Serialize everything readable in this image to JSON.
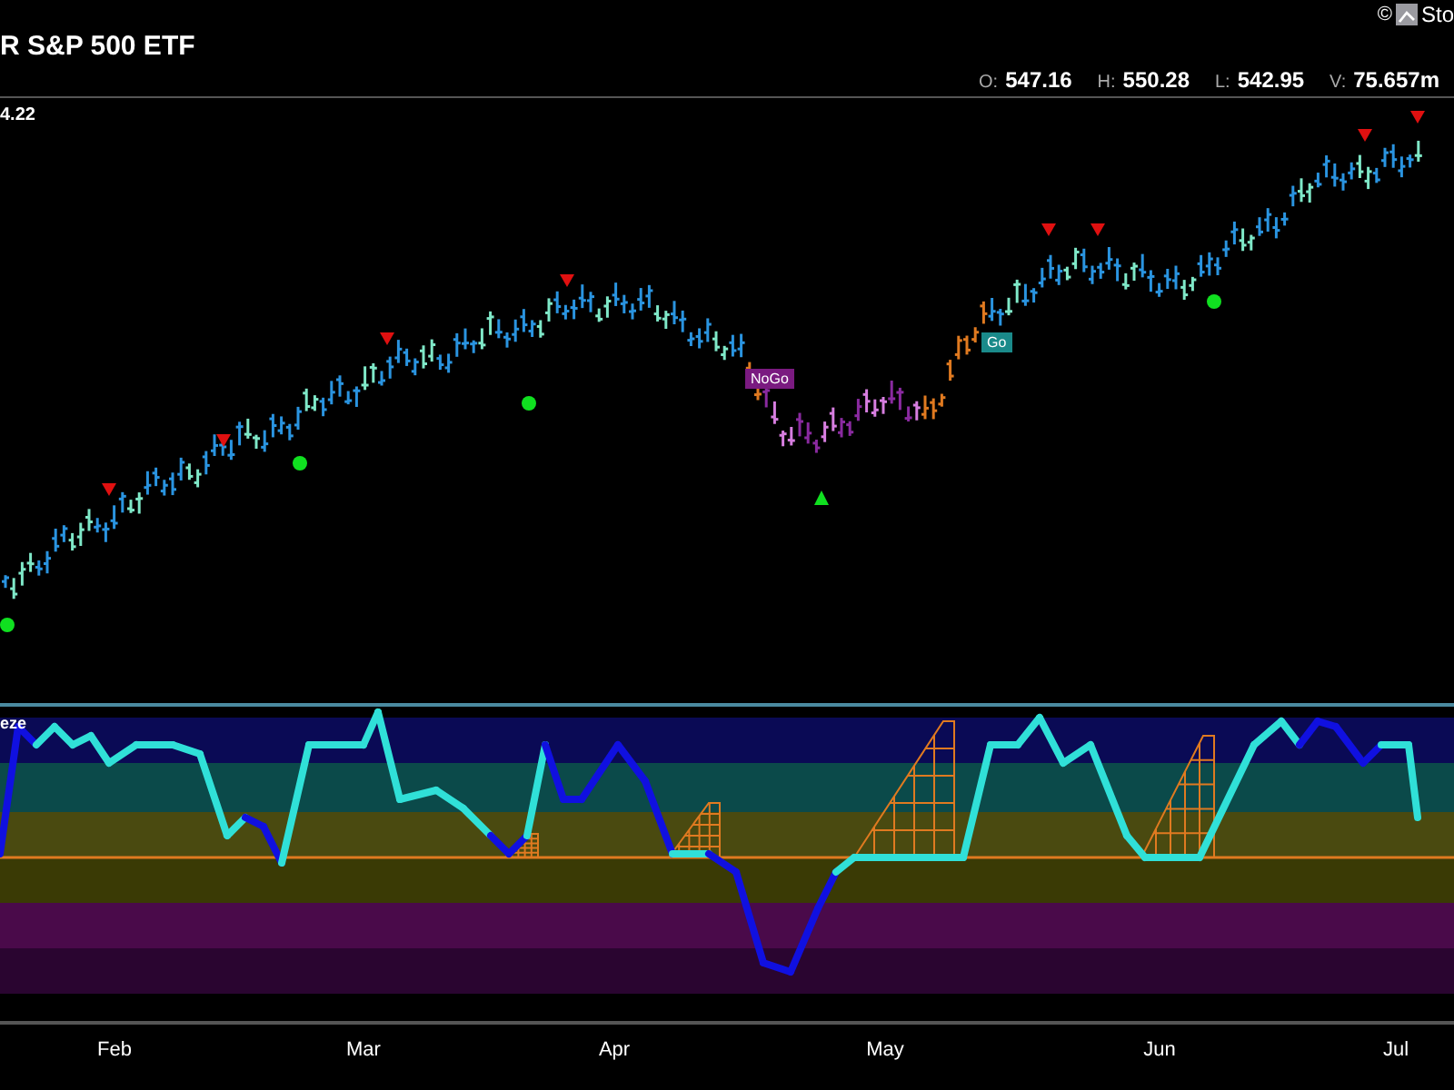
{
  "header": {
    "title": "R S&P 500 ETF",
    "copyright": "©",
    "credit": "Sto",
    "quote": [
      {
        "label": "O:",
        "value": "547.16"
      },
      {
        "label": "H:",
        "value": "550.28"
      },
      {
        "label": "L:",
        "value": "542.95"
      },
      {
        "label": "V:",
        "value": "75.657m"
      }
    ]
  },
  "price_panel": {
    "last_value": "4.22",
    "signals": [
      {
        "kind": "nogo",
        "text": "NoGo"
      },
      {
        "kind": "go",
        "text": "Go"
      }
    ]
  },
  "oscillator": {
    "label": "eze"
  },
  "x_axis": {
    "labels": [
      "Feb",
      "Mar",
      "Apr",
      "May",
      "Jun",
      "Jul"
    ]
  }
}
